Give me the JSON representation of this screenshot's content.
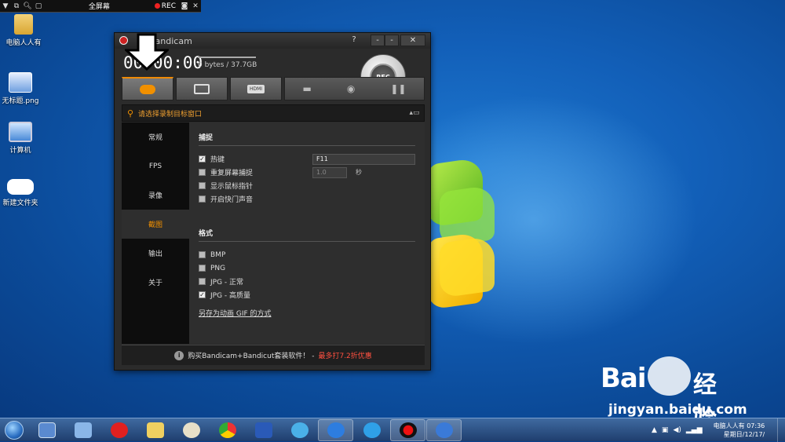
{
  "capture_bar": {
    "mode_label": "全屏幕",
    "rec_label": "REC"
  },
  "desktop_icons": [
    {
      "label": "电脑人人有"
    },
    {
      "label": "无标题.png"
    },
    {
      "label": "计算机"
    },
    {
      "label": "新建文件夹"
    }
  ],
  "bandicam": {
    "title": "Bandicam",
    "timer": "00:00:00",
    "file_size": "0 bytes / 37.7GB",
    "rec_button": "REC",
    "help_btn": "?",
    "min_btn": "-",
    "close_btn": "✕",
    "tabs": [
      {
        "name": "game-mode",
        "active": true
      },
      {
        "name": "screen-mode",
        "active": false
      },
      {
        "name": "hdmi-mode",
        "active": false,
        "label": "HDMI"
      }
    ],
    "target_text": "请选择录制目标窗口",
    "nav": [
      {
        "label": "常规",
        "active": false
      },
      {
        "label": "FPS",
        "active": false
      },
      {
        "label": "录像",
        "active": false
      },
      {
        "label": "截图",
        "active": true
      },
      {
        "label": "输出",
        "active": false
      },
      {
        "label": "关于",
        "active": false
      }
    ],
    "capture_section": {
      "title": "捕捉",
      "hotkey": {
        "label": "热键",
        "checked": true,
        "value": "F11"
      },
      "repeat": {
        "label": "重复屏幕捕捉",
        "checked": false,
        "value": "1.0",
        "unit": "秒"
      },
      "cursor": {
        "label": "显示鼠标指针",
        "checked": false
      },
      "shutter": {
        "label": "开启快门声音",
        "checked": false
      }
    },
    "format_section": {
      "title": "格式",
      "options": [
        {
          "label": "BMP",
          "checked": false
        },
        {
          "label": "PNG",
          "checked": false
        },
        {
          "label": "JPG - 正常",
          "checked": false
        },
        {
          "label": "JPG - 高质量",
          "checked": true
        }
      ],
      "gif_link": "另存为动画 GIF 的方式"
    },
    "footer": {
      "info": "i",
      "text": "购买Bandicam+Bandicut套装软件！ - ",
      "promo": "最多打7.2折优惠"
    }
  },
  "watermark": {
    "brand": "Bai",
    "brand2": "经验",
    "url": "jingyan.baidu.com"
  },
  "taskbar": {
    "clock_user": "电脑人人有",
    "clock_time": "07:36",
    "clock_date": "星期日/12/17/"
  },
  "colors": {
    "accent": "#f19000",
    "promo": "#ff5040",
    "desktop": "#125fb8"
  }
}
